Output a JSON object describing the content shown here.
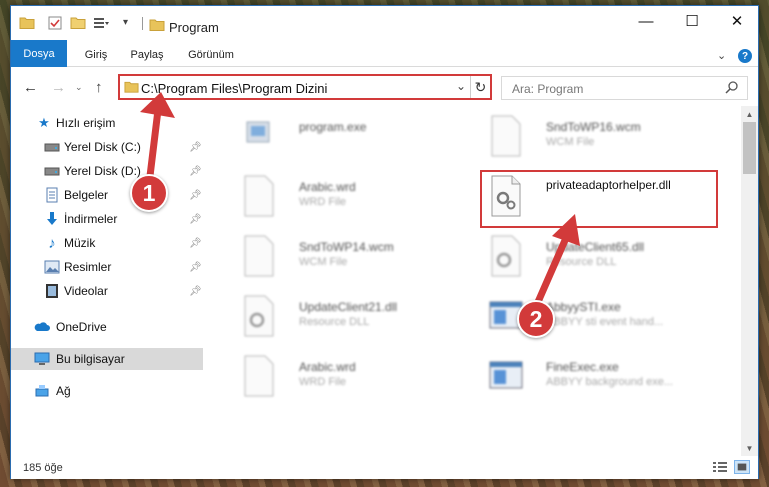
{
  "window": {
    "title": "Program",
    "controls": {
      "minimize": "—",
      "maximize": "☐",
      "close": "✕"
    }
  },
  "ribbon": {
    "tabs": [
      {
        "label": "Dosya",
        "active": true
      },
      {
        "label": "Giriş"
      },
      {
        "label": "Paylaş"
      },
      {
        "label": "Görünüm"
      }
    ],
    "expand_icon": "chevron-down-icon",
    "help_label": "?"
  },
  "navigation": {
    "address_path": "C:\\Program Files\\Program Dizini",
    "search_placeholder": "Ara: Program"
  },
  "sidebar": {
    "items": [
      {
        "label": "Hızlı erişim",
        "icon": "star-icon"
      },
      {
        "label": "Yerel Disk (C:)",
        "icon": "drive-icon",
        "pinned": true
      },
      {
        "label": "Yerel Disk (D:)",
        "icon": "drive-icon",
        "pinned": true
      },
      {
        "label": "Belgeler",
        "icon": "documents-icon",
        "pinned": true
      },
      {
        "label": "İndirmeler",
        "icon": "download-icon",
        "pinned": true
      },
      {
        "label": "Müzik",
        "icon": "music-icon",
        "pinned": true
      },
      {
        "label": "Resimler",
        "icon": "pictures-icon",
        "pinned": true
      },
      {
        "label": "Videolar",
        "icon": "videos-icon",
        "pinned": true
      },
      {
        "label": "OneDrive",
        "icon": "cloud-icon"
      },
      {
        "label": "Bu bilgisayar",
        "icon": "computer-icon",
        "selected": true
      },
      {
        "label": "Ağ",
        "icon": "network-icon"
      }
    ]
  },
  "files": [
    {
      "name": "program.exe",
      "type": "",
      "icon": "exe-icon"
    },
    {
      "name": "SndToWP16.wcm",
      "type": "WCM File",
      "icon": "file-icon"
    },
    {
      "name": "Arabic.wrd",
      "type": "WRD File",
      "icon": "file-icon"
    },
    {
      "name": "privateadaptorhelper.dll",
      "type": "",
      "icon": "dll-gear-icon",
      "highlighted": true
    },
    {
      "name": "SndToWP14.wcm",
      "type": "WCM File",
      "icon": "file-icon"
    },
    {
      "name": "UpdateClient65.dll",
      "type": "Resource DLL",
      "icon": "dll-gear-icon"
    },
    {
      "name": "UpdateClient21.dll",
      "type": "Resource DLL",
      "icon": "dll-gear-icon"
    },
    {
      "name": "AbbyySTI.exe",
      "type": "ABBYY sti event hand...",
      "icon": "app-window-icon"
    },
    {
      "name": "Arabic.wrd",
      "type": "WRD File",
      "icon": "file-icon"
    },
    {
      "name": "FineExec.exe",
      "type": "ABBYY background exe...",
      "icon": "app-window-icon"
    }
  ],
  "status": {
    "item_count": "185 öğe"
  },
  "annotations": [
    {
      "label": "1"
    },
    {
      "label": "2"
    }
  ],
  "colors": {
    "accent": "#1979ca",
    "annotation_red": "#d23a3a",
    "selected_bg": "#d9d9d9"
  }
}
